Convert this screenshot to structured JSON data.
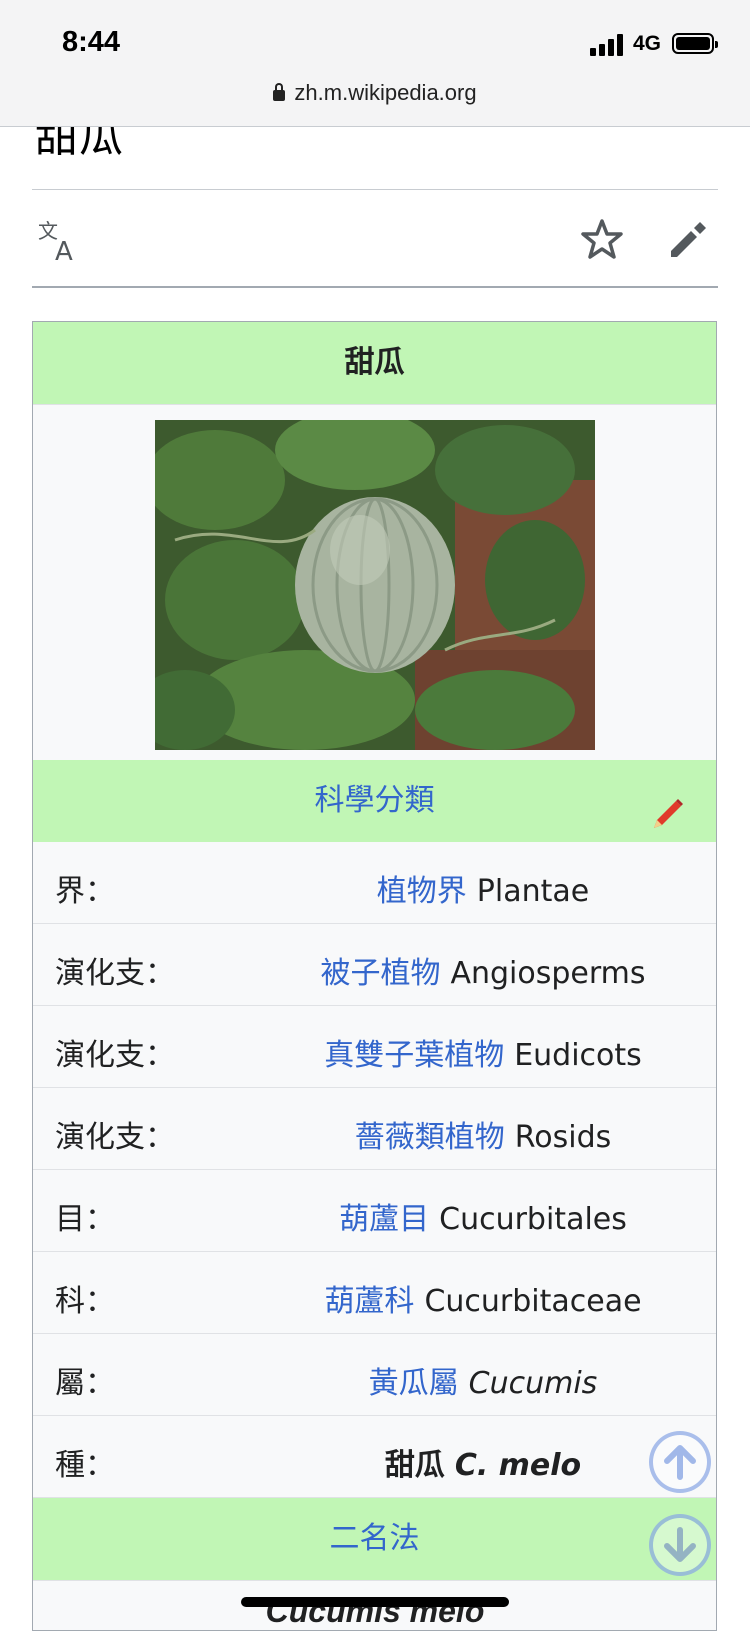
{
  "status_bar": {
    "time": "8:44",
    "network": "4G",
    "url": "zh.m.wikipedia.org"
  },
  "page": {
    "title": "甜瓜"
  },
  "toolbar": {
    "icons": [
      "translate-icon",
      "star-icon",
      "edit-pencil-icon"
    ]
  },
  "infobox": {
    "title": "甜瓜",
    "image": "cantaloupe-melon-photo",
    "taxonomy_heading": "科學分類",
    "rows": [
      {
        "label": "界：",
        "link": "植物界",
        "latin": "Plantae",
        "italic": false
      },
      {
        "label": "演化支：",
        "link": "被子植物",
        "latin": "Angiosperms",
        "italic": false
      },
      {
        "label": "演化支：",
        "link": "真雙子葉植物",
        "latin": "Eudicots",
        "italic": false
      },
      {
        "label": "演化支：",
        "link": "薔薇類植物",
        "latin": "Rosids",
        "italic": false
      },
      {
        "label": "目：",
        "link": "葫蘆目",
        "latin": "Cucurbitales",
        "italic": false
      },
      {
        "label": "科：",
        "link": "葫蘆科",
        "latin": "Cucurbitaceae",
        "italic": false
      },
      {
        "label": "屬：",
        "link": "黃瓜屬",
        "latin": "Cucumis",
        "italic": true
      }
    ],
    "species": {
      "label": "種：",
      "name": "甜瓜",
      "latin": "C. melo"
    },
    "binomial_heading": "二名法",
    "binomial_name": "Cucumis melo"
  },
  "colors": {
    "infobox_header": "#c1f6b5",
    "link": "#3366cc"
  }
}
